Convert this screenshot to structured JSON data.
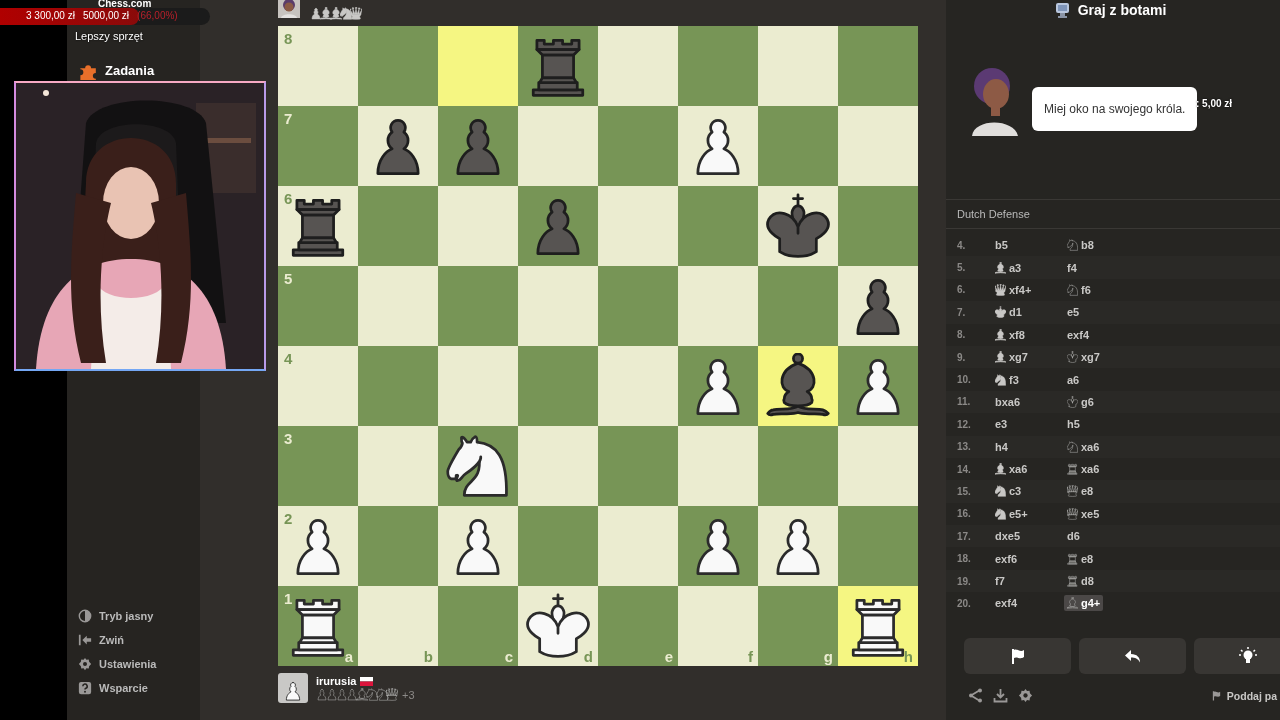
{
  "overlay": {
    "logo": "Chess.com",
    "donation": {
      "raised": "3 300,00 zł",
      "goal": "5000,00 zł",
      "percent": "(66,00%)",
      "level": 0.66
    },
    "banner": "Lepszy sprzęt",
    "tip": ": 5,00 zł"
  },
  "sidebar": {
    "items": [
      {
        "label": "Zadania",
        "kind": "puzzle"
      }
    ],
    "footer": [
      {
        "label": "Tryb jasny",
        "kind": "contrast"
      },
      {
        "label": "Zwiń",
        "kind": "collapse"
      },
      {
        "label": "Ustawienia",
        "kind": "settings"
      },
      {
        "label": "Wsparcie",
        "kind": "help"
      }
    ]
  },
  "opponent": {
    "captured": [
      {
        "kind": "pawn"
      },
      {
        "kind": "bishop"
      },
      {
        "kind": "bishop"
      },
      {
        "kind": "knight"
      },
      {
        "kind": "queen"
      }
    ]
  },
  "board": {
    "rank_labels": [
      "8",
      "7",
      "6",
      "5",
      "4",
      "3",
      "2",
      "1"
    ],
    "file_labels": [
      "a",
      "b",
      "c",
      "d",
      "e",
      "f",
      "g",
      "h"
    ],
    "rows": [
      [
        {
          "kind": "empty",
          "highlighted": false
        },
        {
          "kind": "empty",
          "highlighted": false
        },
        {
          "kind": "empty",
          "highlighted": true
        },
        {
          "kind": "rook",
          "black": true,
          "highlighted": false
        },
        {
          "kind": "empty",
          "highlighted": false
        },
        {
          "kind": "empty",
          "highlighted": false
        },
        {
          "kind": "empty",
          "highlighted": false
        },
        {
          "kind": "empty",
          "highlighted": false
        }
      ],
      [
        {
          "kind": "empty",
          "highlighted": false
        },
        {
          "kind": "pawn",
          "black": true,
          "highlighted": false
        },
        {
          "kind": "pawn",
          "black": true,
          "highlighted": false
        },
        {
          "kind": "empty",
          "highlighted": false
        },
        {
          "kind": "empty",
          "highlighted": false
        },
        {
          "kind": "pawn",
          "black": false,
          "highlighted": false
        },
        {
          "kind": "empty",
          "highlighted": false
        },
        {
          "kind": "empty",
          "highlighted": false
        }
      ],
      [
        {
          "kind": "rook",
          "black": true,
          "highlighted": false
        },
        {
          "kind": "empty",
          "highlighted": false
        },
        {
          "kind": "empty",
          "highlighted": false
        },
        {
          "kind": "pawn",
          "black": true,
          "highlighted": false
        },
        {
          "kind": "empty",
          "highlighted": false
        },
        {
          "kind": "empty",
          "highlighted": false
        },
        {
          "kind": "king",
          "black": true,
          "highlighted": false
        },
        {
          "kind": "empty",
          "highlighted": false
        }
      ],
      [
        {
          "kind": "empty",
          "highlighted": false
        },
        {
          "kind": "empty",
          "highlighted": false
        },
        {
          "kind": "empty",
          "highlighted": false
        },
        {
          "kind": "empty",
          "highlighted": false
        },
        {
          "kind": "empty",
          "highlighted": false
        },
        {
          "kind": "empty",
          "highlighted": false
        },
        {
          "kind": "empty",
          "highlighted": false
        },
        {
          "kind": "pawn",
          "black": true,
          "highlighted": false
        }
      ],
      [
        {
          "kind": "empty",
          "highlighted": false
        },
        {
          "kind": "empty",
          "highlighted": false
        },
        {
          "kind": "empty",
          "highlighted": false
        },
        {
          "kind": "empty",
          "highlighted": false
        },
        {
          "kind": "empty",
          "highlighted": false
        },
        {
          "kind": "pawn",
          "black": false,
          "highlighted": false
        },
        {
          "kind": "bishop",
          "black": true,
          "highlighted": true
        },
        {
          "kind": "pawn",
          "black": false,
          "highlighted": false
        }
      ],
      [
        {
          "kind": "empty",
          "highlighted": false
        },
        {
          "kind": "empty",
          "highlighted": false
        },
        {
          "kind": "knight",
          "black": false,
          "highlighted": false
        },
        {
          "kind": "empty",
          "highlighted": false
        },
        {
          "kind": "empty",
          "highlighted": false
        },
        {
          "kind": "empty",
          "highlighted": false
        },
        {
          "kind": "empty",
          "highlighted": false
        },
        {
          "kind": "empty",
          "highlighted": false
        }
      ],
      [
        {
          "kind": "pawn",
          "black": false,
          "highlighted": false
        },
        {
          "kind": "empty",
          "highlighted": false
        },
        {
          "kind": "pawn",
          "black": false,
          "highlighted": false
        },
        {
          "kind": "empty",
          "highlighted": false
        },
        {
          "kind": "empty",
          "highlighted": false
        },
        {
          "kind": "pawn",
          "black": false,
          "highlighted": false
        },
        {
          "kind": "pawn",
          "black": false,
          "highlighted": false
        },
        {
          "kind": "empty",
          "highlighted": false
        }
      ],
      [
        {
          "kind": "rook",
          "black": false,
          "highlighted": false
        },
        {
          "kind": "empty",
          "highlighted": false
        },
        {
          "kind": "empty",
          "highlighted": false
        },
        {
          "kind": "king",
          "black": false,
          "highlighted": false
        },
        {
          "kind": "empty",
          "highlighted": false
        },
        {
          "kind": "empty",
          "highlighted": false
        },
        {
          "kind": "empty",
          "highlighted": false
        },
        {
          "kind": "rook",
          "black": false,
          "highlighted": true
        }
      ]
    ]
  },
  "player": {
    "name": "irurusia",
    "captured": [
      {
        "kind": "pawn"
      },
      {
        "kind": "pawn"
      },
      {
        "kind": "pawn"
      },
      {
        "kind": "pawn"
      },
      {
        "kind": "bishop"
      },
      {
        "kind": "knight"
      },
      {
        "kind": "knight"
      },
      {
        "kind": "queen"
      }
    ],
    "advantage": "+3"
  },
  "panel": {
    "title": "Graj z botami",
    "bot_message": "Miej oko na swojego króla.",
    "opening": "Dutch Defense",
    "moves": [
      {
        "number": "4.",
        "white": {
          "kind": "pawn",
          "san": "b5",
          "selected": false
        },
        "black": {
          "kind": "knight",
          "san": "b8",
          "selected": false
        }
      },
      {
        "number": "5.",
        "white": {
          "kind": "bishop",
          "san": "a3",
          "selected": false
        },
        "black": {
          "kind": "pawn",
          "san": "f4",
          "selected": false
        }
      },
      {
        "number": "6.",
        "white": {
          "kind": "queen",
          "san": "xf4+",
          "selected": false
        },
        "black": {
          "kind": "knight",
          "san": "f6",
          "selected": false
        }
      },
      {
        "number": "7.",
        "white": {
          "kind": "king",
          "san": "d1",
          "selected": false
        },
        "black": {
          "kind": "pawn",
          "san": "e5",
          "selected": false
        }
      },
      {
        "number": "8.",
        "white": {
          "kind": "bishop",
          "san": "xf8",
          "selected": false
        },
        "black": {
          "kind": "pawn",
          "san": "exf4",
          "selected": false
        }
      },
      {
        "number": "9.",
        "white": {
          "kind": "bishop",
          "san": "xg7",
          "selected": false
        },
        "black": {
          "kind": "king",
          "san": "xg7",
          "selected": false
        }
      },
      {
        "number": "10.",
        "white": {
          "kind": "knight",
          "san": "f3",
          "selected": false
        },
        "black": {
          "kind": "pawn",
          "san": "a6",
          "selected": false
        }
      },
      {
        "number": "11.",
        "white": {
          "kind": "pawn",
          "san": "bxa6",
          "selected": false
        },
        "black": {
          "kind": "king",
          "san": "g6",
          "selected": false
        }
      },
      {
        "number": "12.",
        "white": {
          "kind": "pawn",
          "san": "e3",
          "selected": false
        },
        "black": {
          "kind": "pawn",
          "san": "h5",
          "selected": false
        }
      },
      {
        "number": "13.",
        "white": {
          "kind": "pawn",
          "san": "h4",
          "selected": false
        },
        "black": {
          "kind": "knight",
          "san": "xa6",
          "selected": false
        }
      },
      {
        "number": "14.",
        "white": {
          "kind": "bishop",
          "san": "xa6",
          "selected": false
        },
        "black": {
          "kind": "rook",
          "san": "xa6",
          "selected": false
        }
      },
      {
        "number": "15.",
        "white": {
          "kind": "knight",
          "san": "c3",
          "selected": false
        },
        "black": {
          "kind": "queen",
          "san": "e8",
          "selected": false
        }
      },
      {
        "number": "16.",
        "white": {
          "kind": "knight",
          "san": "e5+",
          "selected": false
        },
        "black": {
          "kind": "queen",
          "san": "xe5",
          "selected": false
        }
      },
      {
        "number": "17.",
        "white": {
          "kind": "pawn",
          "san": "dxe5",
          "selected": false
        },
        "black": {
          "kind": "pawn",
          "san": "d6",
          "selected": false
        }
      },
      {
        "number": "18.",
        "white": {
          "kind": "pawn",
          "san": "exf6",
          "selected": false
        },
        "black": {
          "kind": "rook",
          "san": "e8",
          "selected": false
        }
      },
      {
        "number": "19.",
        "white": {
          "kind": "pawn",
          "san": "f7",
          "selected": false
        },
        "black": {
          "kind": "rook",
          "san": "d8",
          "selected": false
        }
      },
      {
        "number": "20.",
        "white": {
          "kind": "pawn",
          "san": "exf4",
          "selected": false
        },
        "black": {
          "kind": "bishop",
          "san": "g4+",
          "selected": true
        }
      }
    ],
    "resign": "Poddaj pa"
  }
}
